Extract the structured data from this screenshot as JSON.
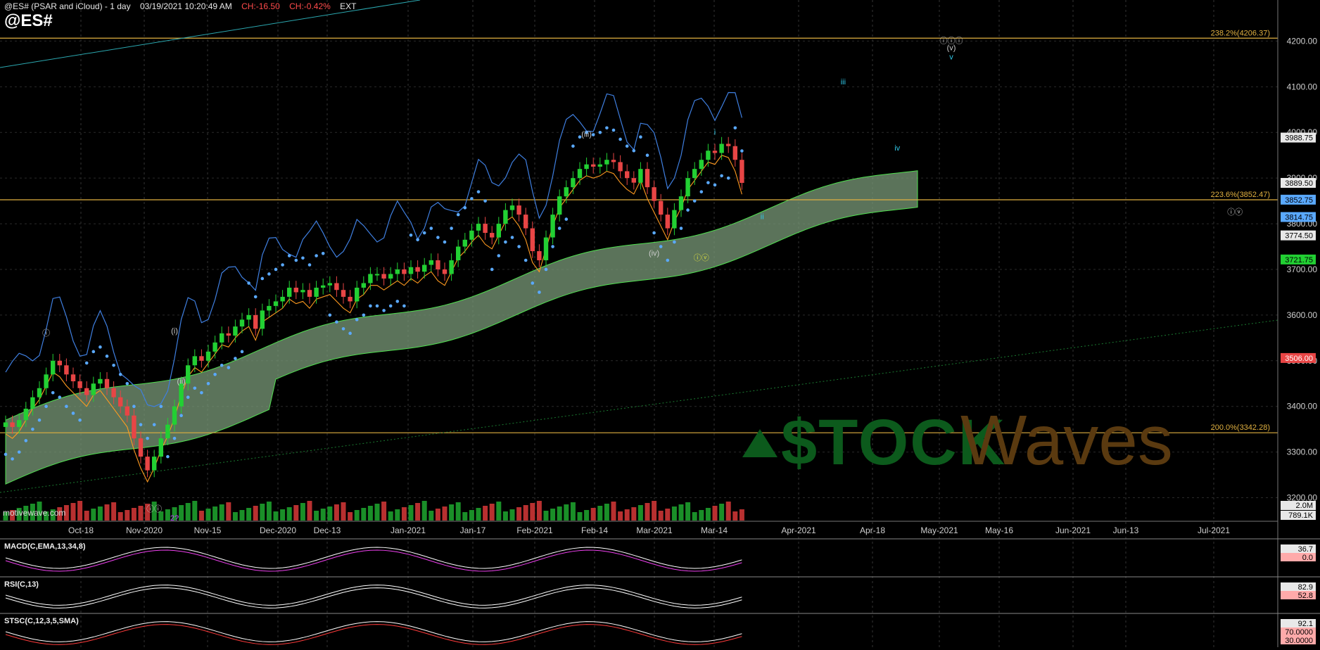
{
  "header": {
    "title": "@ES# (PSAR and iCloud) - 1 day",
    "datetime": "03/19/2021 10:20:49 AM",
    "change": "CH:-16.50",
    "change_pct": "CH:-0.42%",
    "session": "EXT",
    "symbol": "@ES#"
  },
  "source_label": "motivewave.com",
  "watermark": {
    "part1": "$TOCK",
    "part2": "Waves",
    "tm": "™"
  },
  "colors": {
    "up": "#22d033",
    "down": "#e84545",
    "psar": "#5aa9ff",
    "cloud": "#7a9a78",
    "fib": "#e0b040",
    "blue": "#3f7fe0",
    "orange": "#ff9a20"
  },
  "chart_data": {
    "type": "candlestick",
    "ylim": [
      3150,
      4290
    ],
    "y_ticks": [
      3200,
      3300,
      3400,
      3500,
      3600,
      3700,
      3800,
      3900,
      4000,
      4100,
      4200
    ],
    "y_tick_labels": [
      "3200.00",
      "3300.00",
      "3400.00",
      "3500.00",
      "3600.00",
      "3700.00",
      "3800.00",
      "3900.00",
      "4000.00",
      "4100.00",
      "4200.00"
    ],
    "x_labels": [
      "Oct-18",
      "Nov-2020",
      "Nov-15",
      "Dec-2020",
      "Dec-13",
      "Jan-2021",
      "Jan-17",
      "Feb-2021",
      "Feb-14",
      "Mar-2021",
      "Mar-14",
      "Apr-2021",
      "Apr-18",
      "May-2021",
      "May-16",
      "Jun-2021",
      "Jun-13",
      "Jul-2021"
    ],
    "fib_levels": [
      {
        "label": "238.2%(4206.37)",
        "value": 4206.37
      },
      {
        "label": "223.6%(3852.47)",
        "value": 3852.47
      },
      {
        "label": "200.0%(3342.28)",
        "value": 3342.28
      }
    ],
    "price_tags": [
      {
        "label": "3988.75",
        "value": 3988.75,
        "color": "#e8e8e8",
        "text": "#000"
      },
      {
        "label": "3889.50",
        "value": 3889.5,
        "color": "#e8e8e8",
        "text": "#000"
      },
      {
        "label": "3852.75",
        "value": 3852.75,
        "color": "#5aa9ff",
        "text": "#000"
      },
      {
        "label": "3814.75",
        "value": 3814.75,
        "color": "#5aa9ff",
        "text": "#000"
      },
      {
        "label": "3774.50",
        "value": 3774.5,
        "color": "#e8e8e8",
        "text": "#000"
      },
      {
        "label": "3721.75",
        "value": 3721.75,
        "color": "#22d033",
        "text": "#000"
      },
      {
        "label": "3506.00",
        "value": 3506,
        "color": "#e84545",
        "text": "#fff"
      }
    ],
    "volume_labels": [
      "2.0M",
      "789.1K"
    ],
    "closes": [
      3365,
      3355,
      3370,
      3395,
      3420,
      3440,
      3470,
      3500,
      3490,
      3470,
      3455,
      3440,
      3425,
      3450,
      3460,
      3440,
      3420,
      3400,
      3380,
      3330,
      3290,
      3260,
      3290,
      3330,
      3360,
      3400,
      3450,
      3490,
      3510,
      3500,
      3520,
      3540,
      3560,
      3555,
      3575,
      3590,
      3600,
      3570,
      3610,
      3620,
      3630,
      3640,
      3660,
      3650,
      3655,
      3640,
      3660,
      3665,
      3670,
      3655,
      3640,
      3630,
      3660,
      3670,
      3690,
      3690,
      3680,
      3690,
      3700,
      3690,
      3705,
      3695,
      3710,
      3720,
      3700,
      3690,
      3720,
      3750,
      3765,
      3785,
      3800,
      3780,
      3770,
      3800,
      3830,
      3840,
      3820,
      3790,
      3740,
      3720,
      3770,
      3820,
      3860,
      3880,
      3900,
      3920,
      3930,
      3925,
      3930,
      3940,
      3935,
      3915,
      3900,
      3890,
      3920,
      3880,
      3850,
      3820,
      3790,
      3830,
      3860,
      3900,
      3920,
      3940,
      3960,
      3955,
      3975,
      3970,
      3940,
      3889.5
    ],
    "waves": [
      {
        "label": "ⓘ",
        "x": 6,
        "y": 3555,
        "color": "#cccccc"
      },
      {
        "label": "ⓘⓘ",
        "x": 22,
        "y": 3170,
        "color": "#cccccc"
      },
      {
        "label": "2?",
        "x": 25,
        "y": 3150,
        "color": "#c040ff"
      },
      {
        "label": "(i)",
        "x": 25,
        "y": 3560,
        "color": "#cccccc"
      },
      {
        "label": "(ii)",
        "x": 26,
        "y": 3450,
        "color": "#cccccc"
      },
      {
        "label": "(iii)",
        "x": 86,
        "y": 3990,
        "color": "#cccccc"
      },
      {
        "label": "(iv)",
        "x": 96,
        "y": 3730,
        "color": "#cccccc"
      },
      {
        "label": "ⓘⓥ",
        "x": 103,
        "y": 3720,
        "color": "#e0e040"
      },
      {
        "label": "i",
        "x": 105,
        "y": 3995,
        "color": "#30c8e8"
      },
      {
        "label": "ii",
        "x": 112,
        "y": 3810,
        "color": "#30c8e8"
      },
      {
        "label": "iii",
        "x": 124,
        "y": 4105,
        "color": "#30c8e8"
      },
      {
        "label": "iv",
        "x": 132,
        "y": 3960,
        "color": "#30c8e8"
      },
      {
        "label": "ⓘⓘⓘ",
        "x": 140,
        "y": 4195,
        "color": "#cccccc"
      },
      {
        "label": "(v)",
        "x": 140,
        "y": 4180,
        "color": "#cccccc"
      },
      {
        "label": "v",
        "x": 140,
        "y": 4160,
        "color": "#30c8e8"
      },
      {
        "label": "ⓘⓥ",
        "x": 182,
        "y": 3820,
        "color": "#cccccc"
      }
    ]
  },
  "indicators": {
    "macd": {
      "title": "MACD(C,EMA,13,34,8)",
      "tags": [
        "36.7",
        "0.0"
      ]
    },
    "rsi": {
      "title": "RSI(C,13)",
      "tags": [
        "82.9",
        "52.8"
      ]
    },
    "stsc": {
      "title": "STSC(C,12,3,5,SMA)",
      "tags": [
        "92.1",
        "70.0000",
        "30.0000"
      ]
    }
  }
}
